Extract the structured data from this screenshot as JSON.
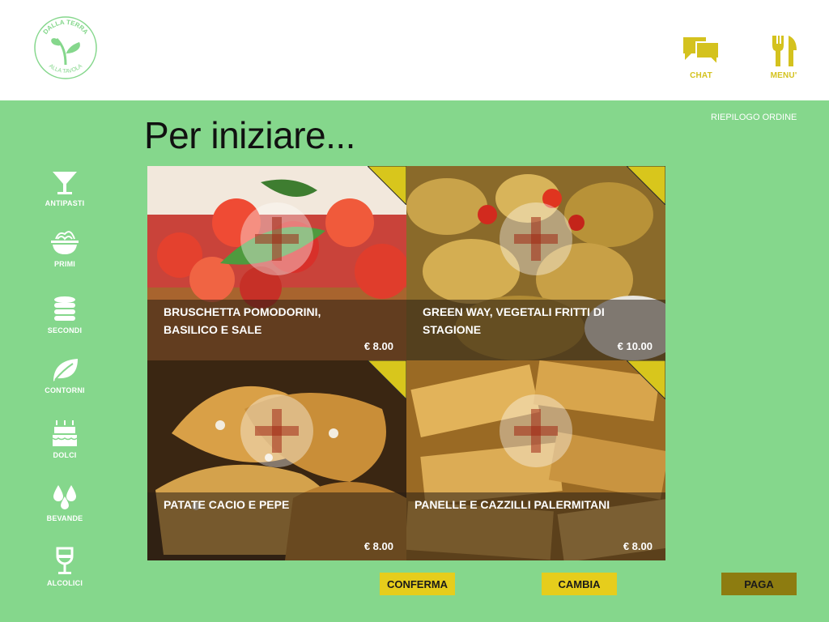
{
  "header": {
    "logo_text_top": "DALLA TERRA",
    "logo_text_bottom": "ALLA TAVOLA",
    "chat_label": "CHAT",
    "menu_label": "MENU'",
    "accent_color": "#d4c21e"
  },
  "summary_link": "RIEPILOGO ORDINE",
  "page_title": "Per iniziare...",
  "sidebar": {
    "items": [
      {
        "label": "ANTIPASTI",
        "icon": "cocktail-glass-icon"
      },
      {
        "label": "PRIMI",
        "icon": "pasta-bowl-icon"
      },
      {
        "label": "SECONDI",
        "icon": "stacked-dishes-icon"
      },
      {
        "label": "CONTORNI",
        "icon": "leaf-icon"
      },
      {
        "label": "DOLCI",
        "icon": "cake-icon"
      },
      {
        "label": "BEVANDE",
        "icon": "water-drops-icon"
      },
      {
        "label": "ALCOLICI",
        "icon": "wine-glass-icon"
      }
    ]
  },
  "dishes": [
    {
      "name": "BRUSCHETTA POMODORINI, BASILICO E SALE",
      "price": "€ 8.00",
      "icon": "plus-icon"
    },
    {
      "name": "GREEN WAY, VEGETALI FRITTI DI STAGIONE",
      "price": "€ 10.00",
      "icon": "plus-icon"
    },
    {
      "name": "PATATE CACIO E PEPE",
      "price": "€ 8.00",
      "icon": "plus-icon"
    },
    {
      "name": "PANELLE E CAZZILLI PALERMITANI",
      "price": "€ 8.00",
      "icon": "plus-icon"
    }
  ],
  "actions": {
    "confirm_label": "CONFERMA",
    "change_label": "CAMBIA",
    "pay_label": "PAGA"
  },
  "colors": {
    "background_green": "#85d78c",
    "button_yellow": "#e6cd1c",
    "button_pay": "#8d7c10",
    "corner_yellow": "#d8c61c"
  }
}
